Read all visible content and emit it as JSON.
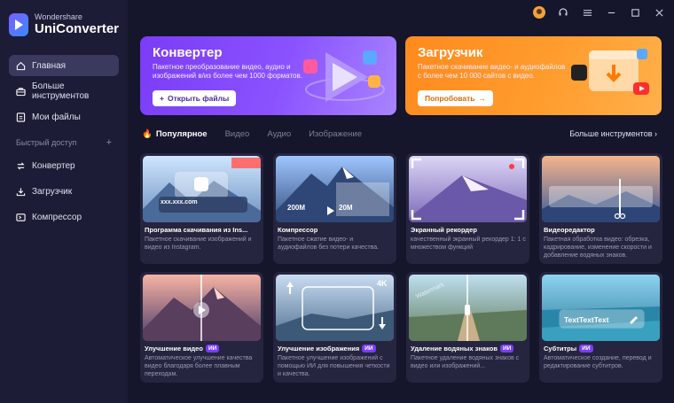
{
  "app": {
    "brand": "Wondershare",
    "product": "UniConverter"
  },
  "sidebar": {
    "items": [
      {
        "label": "Главная",
        "icon": "home-icon",
        "active": true
      },
      {
        "label": "Больше инструментов",
        "icon": "toolbox-icon",
        "active": false
      },
      {
        "label": "Мои файлы",
        "icon": "files-icon",
        "active": false
      }
    ],
    "quick_access_label": "Быстрый доступ",
    "quick_items": [
      {
        "label": "Конвертер",
        "icon": "converter-icon"
      },
      {
        "label": "Загрузчик",
        "icon": "download-icon"
      },
      {
        "label": "Компрессор",
        "icon": "compress-icon"
      }
    ]
  },
  "banners": {
    "converter": {
      "title": "Конвертер",
      "description": "Пакетное преобразование видео, аудио и изображений в/из более чем 1000 форматов.",
      "button": "Открыть файлы"
    },
    "downloader": {
      "title": "Загрузчик",
      "description": "Пакетное скачивание видео- и аудиофайлов с более чем 10 000 сайтов с видео.",
      "button": "Попробовать"
    }
  },
  "tabs": [
    "Популярное",
    "Видео",
    "Аудио",
    "Изображение"
  ],
  "more_tools": "Больше инструментов",
  "cards": [
    {
      "title": "Программа скачивания из Ins...",
      "desc": "Пакетное скачивание изображений и видео из Instagram.",
      "ai": false,
      "thumb_text": "xxx.xxx.com"
    },
    {
      "title": "Компрессор",
      "desc": "Пакетное сжатие видео- и аудиофайлов без потери качества.",
      "ai": false,
      "from": "200M",
      "to": "20M"
    },
    {
      "title": "Экранный рекордер",
      "desc": "качественный экранный рекордер 1: 1 с множеством функций",
      "ai": false
    },
    {
      "title": "Видеоредактор",
      "desc": "Пакетная обработка видео: обрезка, кадрирование, изменение скорости и добавление водяных знаков.",
      "ai": false
    },
    {
      "title": "Улучшение видео",
      "desc": "Автоматическое улучшение качества видео благодаря более плавным переходам.",
      "ai": true
    },
    {
      "title": "Улучшение изображения",
      "desc": "Пакетное улучшение изображений с помощью ИИ для повышения четкости и качества.",
      "ai": true,
      "badge": "4K"
    },
    {
      "title": "Удаление водяных знаков",
      "desc": "Пакетное удаление водяных знаков с видео или изображений...",
      "ai": true,
      "watermark": "Watermark"
    },
    {
      "title": "Субтитры",
      "desc": "Автоматическое создание, перевод и редактирование субтитров.",
      "ai": true,
      "thumb_text": "TextTextText"
    }
  ],
  "ai_label": "ИИ",
  "colors": {
    "accent_purple": "#7b3cf5",
    "accent_orange": "#ff8a1d",
    "sidebar_bg": "#1c1c36",
    "main_bg": "#15152b"
  }
}
